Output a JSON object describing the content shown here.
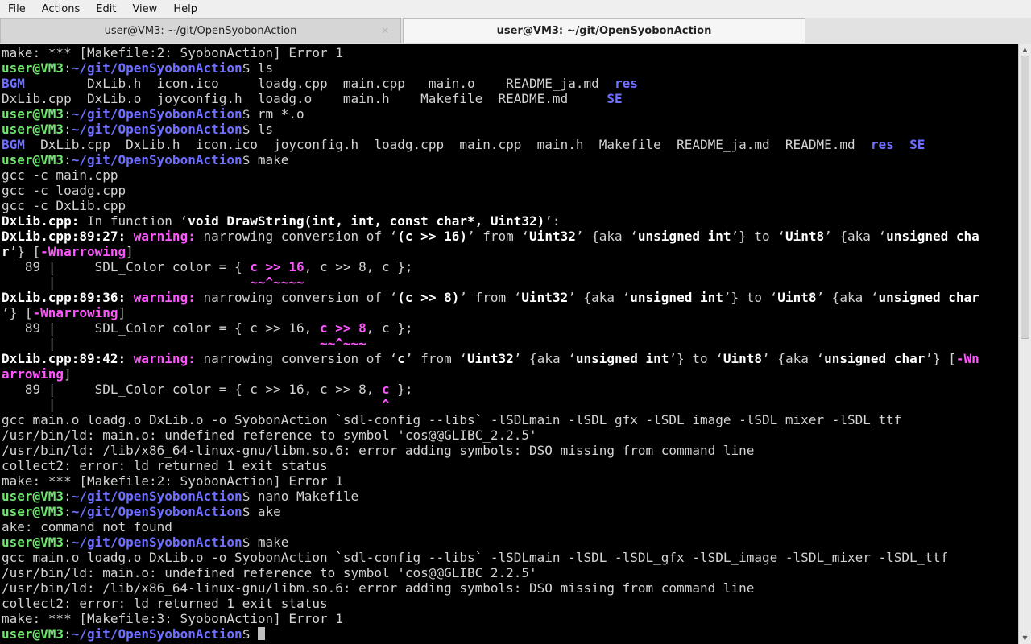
{
  "menubar": {
    "items": [
      "File",
      "Actions",
      "Edit",
      "View",
      "Help"
    ]
  },
  "tabs": [
    {
      "title": "user@VM3: ~/git/OpenSyobonAction",
      "active": false
    },
    {
      "title": "user@VM3: ~/git/OpenSyobonAction",
      "active": true
    }
  ],
  "prompt": {
    "user": "user@VM3",
    "path": "~/git/OpenSyobonAction"
  },
  "terminal": {
    "lines": [
      [
        [
          "make: *** [Makefile:2: SyobonAction] Error 1",
          ""
        ]
      ],
      [
        [
          "user@VM3",
          "u"
        ],
        [
          ":",
          ""
        ],
        [
          "~/git/OpenSyobonAction",
          "p"
        ],
        [
          "$ ls",
          ""
        ]
      ],
      [
        [
          "BGM",
          "blue"
        ],
        [
          "        DxLib.h  icon.ico     loadg.cpp  main.cpp   main.o    README_ja.md  ",
          ""
        ],
        [
          "res",
          "blue"
        ]
      ],
      [
        [
          "DxLib.cpp  DxLib.o  joyconfig.h  loadg.o    main.h    Makefile  README.md     ",
          ""
        ],
        [
          "SE",
          "blue"
        ]
      ],
      [
        [
          "user@VM3",
          "u"
        ],
        [
          ":",
          ""
        ],
        [
          "~/git/OpenSyobonAction",
          "p"
        ],
        [
          "$ rm *.o",
          ""
        ]
      ],
      [
        [
          "user@VM3",
          "u"
        ],
        [
          ":",
          ""
        ],
        [
          "~/git/OpenSyobonAction",
          "p"
        ],
        [
          "$ ls",
          ""
        ]
      ],
      [
        [
          "BGM",
          "blue"
        ],
        [
          "  DxLib.cpp  DxLib.h  icon.ico  joyconfig.h  loadg.cpp  main.cpp  main.h  Makefile  README_ja.md  README.md  ",
          ""
        ],
        [
          "res",
          "blue"
        ],
        [
          "  ",
          ""
        ],
        [
          "SE",
          "blue"
        ]
      ],
      [
        [
          "user@VM3",
          "u"
        ],
        [
          ":",
          ""
        ],
        [
          "~/git/OpenSyobonAction",
          "p"
        ],
        [
          "$ make",
          ""
        ]
      ],
      [
        [
          "gcc -c main.cpp",
          ""
        ]
      ],
      [
        [
          "gcc -c loadg.cpp",
          ""
        ]
      ],
      [
        [
          "gcc -c DxLib.cpp",
          ""
        ]
      ],
      [
        [
          "DxLib.cpp:",
          "b"
        ],
        [
          " In function ‘",
          ""
        ],
        [
          "void DrawString(int, int, const char*, Uint32)",
          "b"
        ],
        [
          "’:",
          ""
        ]
      ],
      [
        [
          "DxLib.cpp:89:27:",
          "b"
        ],
        [
          " ",
          ""
        ],
        [
          "warning:",
          "m"
        ],
        [
          " narrowing conversion of ‘",
          ""
        ],
        [
          "(c >> 16)",
          "b"
        ],
        [
          "’ from ‘",
          ""
        ],
        [
          "Uint32",
          "b"
        ],
        [
          "’ {aka ‘",
          ""
        ],
        [
          "unsigned int",
          "b"
        ],
        [
          "’} to ‘",
          ""
        ],
        [
          "Uint8",
          "b"
        ],
        [
          "’ {aka ‘",
          ""
        ],
        [
          "unsigned cha",
          "b"
        ]
      ],
      [
        [
          "r",
          "b"
        ],
        [
          "’} [",
          ""
        ],
        [
          "-Wnarrowing",
          "m"
        ],
        [
          "]",
          ""
        ]
      ],
      [
        [
          "   89 |     SDL_Color color = { ",
          ""
        ],
        [
          "c >> 16",
          "m"
        ],
        [
          ", c >> 8, c };",
          ""
        ]
      ],
      [
        [
          "      |                         ",
          ""
        ],
        [
          "~~^~~~~",
          "m"
        ]
      ],
      [
        [
          "DxLib.cpp:89:36:",
          "b"
        ],
        [
          " ",
          ""
        ],
        [
          "warning:",
          "m"
        ],
        [
          " narrowing conversion of ‘",
          ""
        ],
        [
          "(c >> 8)",
          "b"
        ],
        [
          "’ from ‘",
          ""
        ],
        [
          "Uint32",
          "b"
        ],
        [
          "’ {aka ‘",
          ""
        ],
        [
          "unsigned int",
          "b"
        ],
        [
          "’} to ‘",
          ""
        ],
        [
          "Uint8",
          "b"
        ],
        [
          "’ {aka ‘",
          ""
        ],
        [
          "unsigned char",
          "b"
        ]
      ],
      [
        [
          "’} [",
          ""
        ],
        [
          "-Wnarrowing",
          "m"
        ],
        [
          "]",
          ""
        ]
      ],
      [
        [
          "   89 |     SDL_Color color = { c >> 16, ",
          ""
        ],
        [
          "c >> 8",
          "m"
        ],
        [
          ", c };",
          ""
        ]
      ],
      [
        [
          "      |                                  ",
          ""
        ],
        [
          "~~^~~~",
          "m"
        ]
      ],
      [
        [
          "DxLib.cpp:89:42:",
          "b"
        ],
        [
          " ",
          ""
        ],
        [
          "warning:",
          "m"
        ],
        [
          " narrowing conversion of ‘",
          ""
        ],
        [
          "c",
          "b"
        ],
        [
          "’ from ‘",
          ""
        ],
        [
          "Uint32",
          "b"
        ],
        [
          "’ {aka ‘",
          ""
        ],
        [
          "unsigned int",
          "b"
        ],
        [
          "’} to ‘",
          ""
        ],
        [
          "Uint8",
          "b"
        ],
        [
          "’ {aka ‘",
          ""
        ],
        [
          "unsigned char",
          "b"
        ],
        [
          "’} [",
          ""
        ],
        [
          "-Wn",
          "m"
        ]
      ],
      [
        [
          "arrowing",
          "m"
        ],
        [
          "]",
          ""
        ]
      ],
      [
        [
          "   89 |     SDL_Color color = { c >> 16, c >> 8, ",
          ""
        ],
        [
          "c",
          "m"
        ],
        [
          " };",
          ""
        ]
      ],
      [
        [
          "      |                                          ",
          ""
        ],
        [
          "^",
          "m"
        ]
      ],
      [
        [
          "gcc main.o loadg.o DxLib.o -o SyobonAction `sdl-config --libs` -lSDLmain -lSDL_gfx -lSDL_image -lSDL_mixer -lSDL_ttf",
          ""
        ]
      ],
      [
        [
          "/usr/bin/ld: main.o: undefined reference to symbol 'cos@@GLIBC_2.2.5'",
          ""
        ]
      ],
      [
        [
          "/usr/bin/ld: /lib/x86_64-linux-gnu/libm.so.6: error adding symbols: DSO missing from command line",
          ""
        ]
      ],
      [
        [
          "collect2: error: ld returned 1 exit status",
          ""
        ]
      ],
      [
        [
          "make: *** [Makefile:2: SyobonAction] Error 1",
          ""
        ]
      ],
      [
        [
          "user@VM3",
          "u"
        ],
        [
          ":",
          ""
        ],
        [
          "~/git/OpenSyobonAction",
          "p"
        ],
        [
          "$ nano Makefile",
          ""
        ]
      ],
      [
        [
          "user@VM3",
          "u"
        ],
        [
          ":",
          ""
        ],
        [
          "~/git/OpenSyobonAction",
          "p"
        ],
        [
          "$ ake",
          ""
        ]
      ],
      [
        [
          "ake: command not found",
          ""
        ]
      ],
      [
        [
          "user@VM3",
          "u"
        ],
        [
          ":",
          ""
        ],
        [
          "~/git/OpenSyobonAction",
          "p"
        ],
        [
          "$ make",
          ""
        ]
      ],
      [
        [
          "gcc main.o loadg.o DxLib.o -o SyobonAction `sdl-config --libs` -lSDLmain -lSDL -lSDL_gfx -lSDL_image -lSDL_mixer -lSDL_ttf",
          ""
        ]
      ],
      [
        [
          "/usr/bin/ld: main.o: undefined reference to symbol 'cos@@GLIBC_2.2.5'",
          ""
        ]
      ],
      [
        [
          "/usr/bin/ld: /lib/x86_64-linux-gnu/libm.so.6: error adding symbols: DSO missing from command line",
          ""
        ]
      ],
      [
        [
          "collect2: error: ld returned 1 exit status",
          ""
        ]
      ],
      [
        [
          "make: *** [Makefile:3: SyobonAction] Error 1",
          ""
        ]
      ],
      [
        [
          "user@VM3",
          "u"
        ],
        [
          ":",
          ""
        ],
        [
          "~/git/OpenSyobonAction",
          "p"
        ],
        [
          "$ ",
          ""
        ]
      ]
    ]
  },
  "colors": {
    "background": "#000000",
    "text": "#d3d3d3",
    "prompt_user": "#6ee36e",
    "prompt_path": "#6f6fff",
    "warning": "#ff55ff",
    "directory": "#6f6fff"
  },
  "icons": {
    "tab_close": "close-icon",
    "scroll_up": "arrow-up-icon",
    "scroll_down": "arrow-down-icon"
  }
}
